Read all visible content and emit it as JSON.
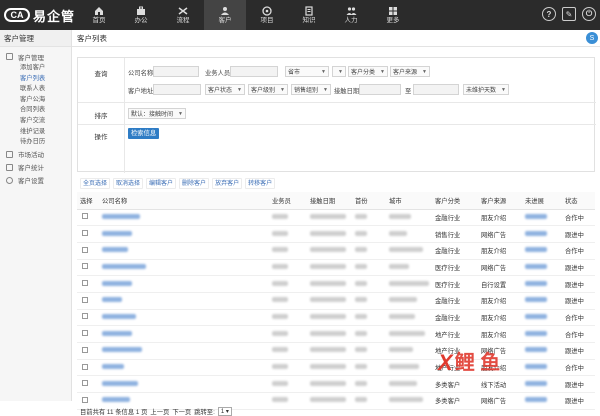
{
  "app": {
    "logo_mark": "CA",
    "logo_text": "易企管"
  },
  "nav": [
    {
      "label": "首页",
      "icon": "home-icon"
    },
    {
      "label": "办公",
      "icon": "briefcase-icon"
    },
    {
      "label": "流程",
      "icon": "flow-icon"
    },
    {
      "label": "客户",
      "icon": "customer-icon"
    },
    {
      "label": "项目",
      "icon": "project-icon"
    },
    {
      "label": "知识",
      "icon": "book-icon"
    },
    {
      "label": "人力",
      "icon": "people-icon"
    },
    {
      "label": "更多",
      "icon": "grid-icon"
    }
  ],
  "top_right": {
    "help": "?",
    "edit": "✎",
    "power": "⏻"
  },
  "sidebar": {
    "title": "客户管理",
    "groups": [
      {
        "label": "客户管理",
        "icon": "doc-icon",
        "items": [
          "添加客户",
          "客户列表",
          "联系人表",
          "客户公海",
          "合同列表",
          "客户交流",
          "维护记录",
          "待办日历"
        ]
      },
      {
        "label": "市场活动",
        "icon": "chart-icon",
        "items": []
      },
      {
        "label": "客户统计",
        "icon": "stats-icon",
        "items": []
      },
      {
        "label": "客户设置",
        "icon": "settings-icon",
        "items": []
      }
    ],
    "active_item": "客户列表"
  },
  "main": {
    "title": "客户列表",
    "edge_badge": "S"
  },
  "filter": {
    "query_label": "查询",
    "sort_label": "排序",
    "action_label": "操作",
    "company_name_label": "公司名称",
    "salesperson_label": "业务人员",
    "province_select": "省市",
    "city_select": "",
    "category_select": "客户分类",
    "source_select": "客户来源",
    "address_label": "客户地址",
    "status_select": "客户状态",
    "level_select": "客户级别",
    "sales_group_select": "销售组别",
    "contact_date_label": "接触日期",
    "date_to_label": "至",
    "maintain_days_select": "未维护天数",
    "sort_select": "默认：接触时间",
    "search_button": "检索信息"
  },
  "actions": [
    "全页选择",
    "取消选择",
    "编辑客户",
    "删除客户",
    "放弃客户",
    "转移客户"
  ],
  "table": {
    "headers": [
      "选择",
      "公司名称",
      "业务员",
      "接触日期",
      "首份",
      "城市",
      "客户分类",
      "客户来源",
      "未进展",
      "状态"
    ],
    "rows": [
      {
        "category": "金融行业",
        "source": "朋友介绍",
        "status": "合作中"
      },
      {
        "category": "销售行业",
        "source": "网络广告",
        "status": "跟进中"
      },
      {
        "category": "金融行业",
        "source": "朋友介绍",
        "status": "合作中"
      },
      {
        "category": "医疗行业",
        "source": "网络广告",
        "status": "跟进中"
      },
      {
        "category": "医疗行业",
        "source": "自行设置",
        "status": "跟进中"
      },
      {
        "category": "金融行业",
        "source": "朋友介绍",
        "status": "跟进中"
      },
      {
        "category": "金融行业",
        "source": "朋友介绍",
        "status": "合作中"
      },
      {
        "category": "地产行业",
        "source": "朋友介绍",
        "status": "合作中"
      },
      {
        "category": "地产行业",
        "source": "网络广告",
        "status": "跟进中"
      },
      {
        "category": "地产行业",
        "source": "朋友介绍",
        "status": "合作中"
      },
      {
        "category": "多类客户",
        "source": "线下活动",
        "status": "跟进中"
      },
      {
        "category": "多类客户",
        "source": "网络广告",
        "status": "跟进中"
      }
    ]
  },
  "pager": {
    "summary": "目前共有 11 条信息 1 页",
    "prev": "上一页",
    "next": "下一页",
    "jump_label": "跳转至:",
    "page_value": "1"
  },
  "watermark": {
    "x": "X",
    "text": "鲤 鱼"
  }
}
